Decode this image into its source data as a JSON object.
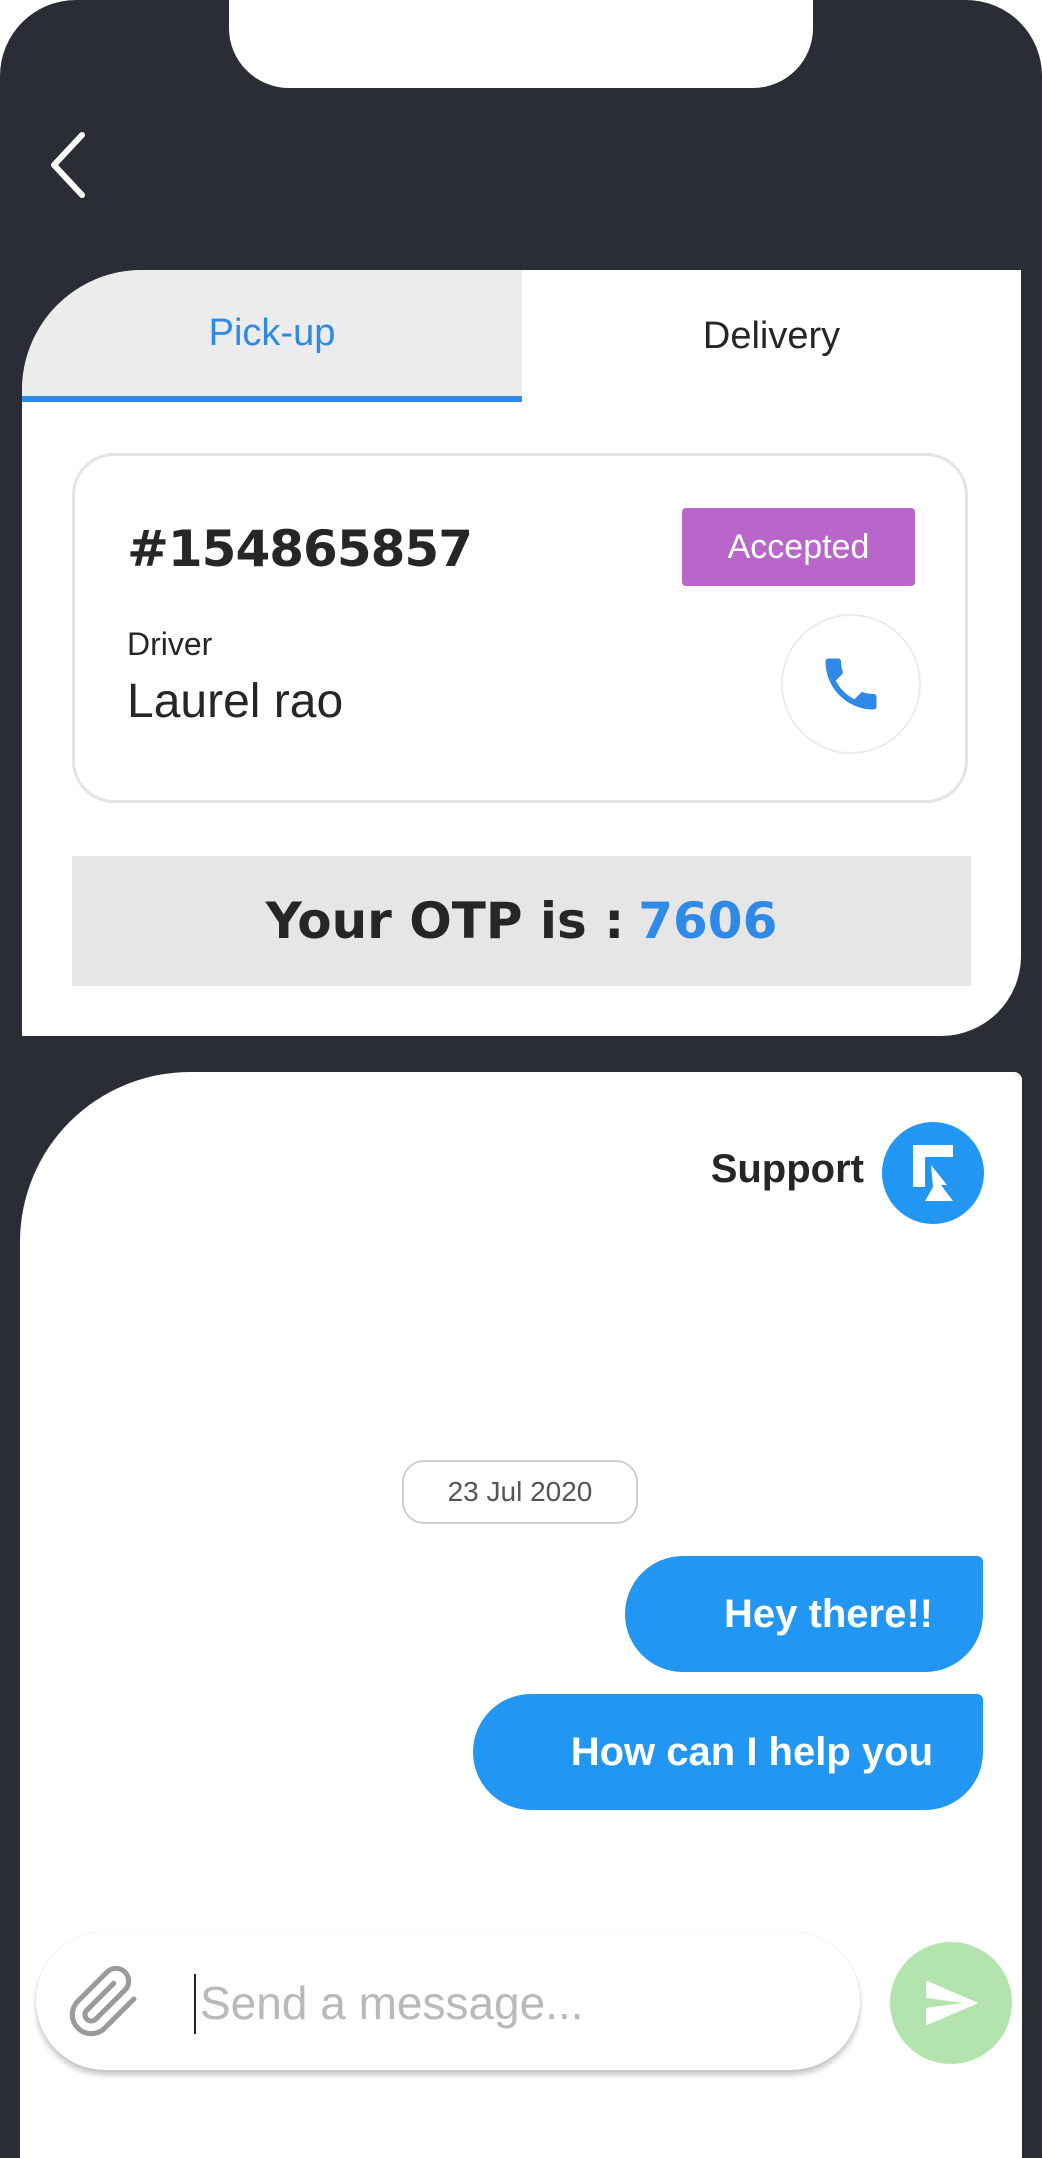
{
  "tabs": [
    {
      "label": "Pick-up",
      "active": true
    },
    {
      "label": "Delivery",
      "active": false
    }
  ],
  "order": {
    "id": "#154865857",
    "status": "Accepted",
    "driver_label": "Driver",
    "driver_name": "Laurel rao"
  },
  "otp": {
    "label": "Your OTP is :",
    "value": "7606"
  },
  "chat": {
    "title": "Support",
    "date": "23 Jul 2020",
    "messages": [
      {
        "text": "Hey there!!"
      },
      {
        "text": "How can I help you"
      }
    ],
    "input_placeholder": "Send a message...",
    "input_value": ""
  },
  "icons": {
    "back": "chevron-left-icon",
    "call": "phone-icon",
    "avatar": "support-logo-icon",
    "attach": "paperclip-icon",
    "send": "send-icon"
  },
  "colors": {
    "background": "#2a2d35",
    "accent": "#2e8ae6",
    "bubble": "#2196f3",
    "status_badge": "#b966cb",
    "send_button": "#b4e4ae"
  }
}
